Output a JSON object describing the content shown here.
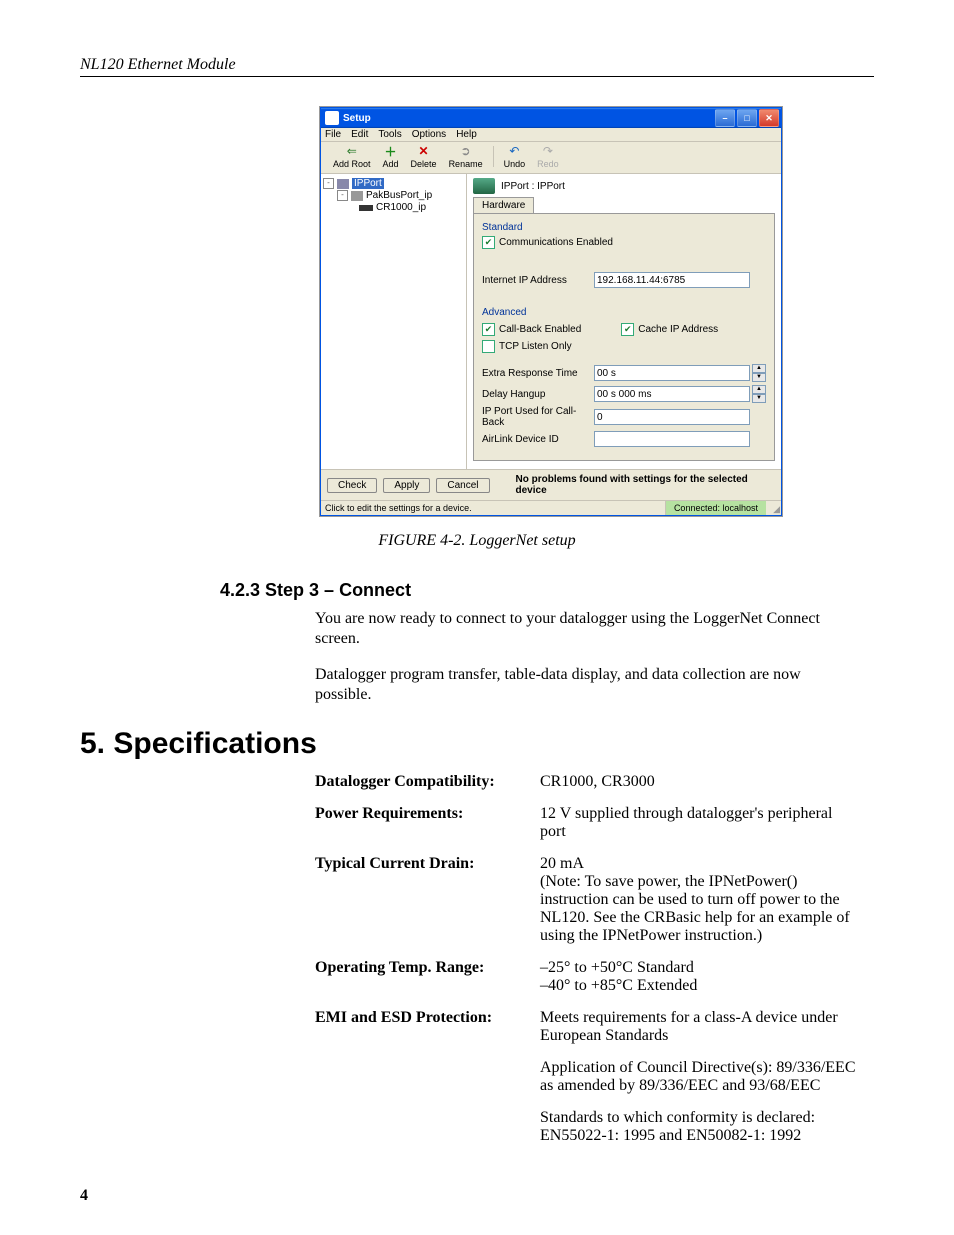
{
  "running_head": "NL120 Ethernet Module",
  "page_number": "4",
  "figure_caption": "FIGURE 4-2.  LoggerNet setup",
  "step3": {
    "heading": "4.2.3  Step 3 – Connect",
    "p1": "You are now ready to connect to your datalogger using the LoggerNet Connect screen.",
    "p2": "Datalogger program transfer, table-data display, and data collection are now possible."
  },
  "specs_heading": "5.    Specifications",
  "specs": {
    "compat_label": "Datalogger Compatibility:",
    "compat_value": "CR1000, CR3000",
    "power_label": "Power Requirements:",
    "power_value": "12 V supplied through datalogger's peripheral port",
    "drain_label": "Typical Current Drain:",
    "drain_value": "20 mA\n(Note: To save power, the IPNetPower() instruction can be used to turn off power to the NL120.  See the CRBasic help for an example of using the IPNetPower instruction.)",
    "temp_label": "Operating Temp. Range:",
    "temp_value": "–25° to +50°C Standard\n–40° to +85°C Extended",
    "emi_label": "EMI and ESD Protection:",
    "emi_v1": "Meets requirements for a class-A device under European Standards",
    "emi_v2": "Application of Council Directive(s): 89/336/EEC as amended by 89/336/EEC and 93/68/EEC",
    "emi_v3": "Standards to which conformity is declared: EN55022-1: 1995 and EN50082-1: 1992"
  },
  "win": {
    "title": "Setup",
    "menu": {
      "file": "File",
      "edit": "Edit",
      "tools": "Tools",
      "options": "Options",
      "help": "Help"
    },
    "toolbar": {
      "add_root": "Add Root",
      "add": "Add",
      "delete": "Delete",
      "rename": "Rename",
      "undo": "Undo",
      "redo": "Redo"
    },
    "tree": {
      "root": "IPPort",
      "child": "PakBusPort_ip",
      "leaf": "CR1000_ip"
    },
    "right_header": "IPPort : IPPort",
    "tab": "Hardware",
    "standard_label": "Standard",
    "comm_enabled": "Communications Enabled",
    "ip_label": "Internet IP Address",
    "ip_value": "192.168.11.44:6785",
    "advanced_label": "Advanced",
    "callback": "Call-Back Enabled",
    "cache": "Cache IP Address",
    "tcp_listen": "TCP Listen Only",
    "extra_resp_label": "Extra Response Time",
    "extra_resp_val": "00 s",
    "delay_label": "Delay Hangup",
    "delay_val": "00 s 000 ms",
    "ipport_label": "IP Port Used for Call-Back",
    "ipport_val": "0",
    "airlink_label": "AirLink Device ID",
    "buttons": {
      "check": "Check",
      "apply": "Apply",
      "cancel": "Cancel"
    },
    "status_msg": "No problems found with settings for the selected device",
    "status_left": "Click to edit the settings for a device.",
    "status_right": "Connected: localhost"
  }
}
